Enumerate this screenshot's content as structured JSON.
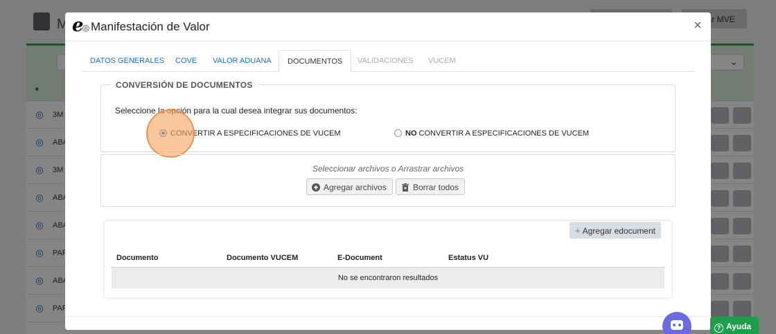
{
  "background": {
    "title_fragment": "M",
    "button_right_label": "gar MVE",
    "row_prefixes": [
      "3M",
      "ABA",
      "3M",
      "ABA",
      "ABA",
      "PAP",
      "ABA",
      "PAF"
    ]
  },
  "modal": {
    "title": "Manifestación de Valor",
    "brand_mark": "e",
    "close_label": "×",
    "tabs": [
      {
        "label": "DATOS GENERALES",
        "state": "link"
      },
      {
        "label": "COVE",
        "state": "link"
      },
      {
        "label": "VALOR ADUANA",
        "state": "link"
      },
      {
        "label": "DOCUMENTOS",
        "state": "active"
      },
      {
        "label": "VALIDACIONES",
        "state": "disabled"
      },
      {
        "label": "VUCEM",
        "state": "disabled"
      }
    ],
    "conversion": {
      "legend": "CONVERSIÓN DE DOCUMENTOS",
      "prompt": "Seleccione la opción para la cual desea integrar sus documentos:",
      "option_convert": "CONVERTIR A ESPECIFICACIONES DE VUCEM",
      "option_no_prefix": "NO",
      "option_no_rest": " CONVERTIR A ESPECIFICACIONES DE VUCEM",
      "selected": "convert"
    },
    "upload": {
      "hint": "Seleccionar archivos o Arrastrar archivos",
      "add_label": "Agregar archivos",
      "clear_label": "Borrar todos"
    },
    "edocuments": {
      "add_label": "Agregar edocument",
      "columns": [
        "Documento",
        "Documento VUCEM",
        "E-Document",
        "Estatus VU"
      ],
      "empty_message": "No se encontraron resultados"
    }
  },
  "widgets": {
    "help_label": "Ayuda",
    "accent_green": "#1e9e4a",
    "bot_color": "#6d6ae0",
    "link_color": "#1b6ec2"
  }
}
